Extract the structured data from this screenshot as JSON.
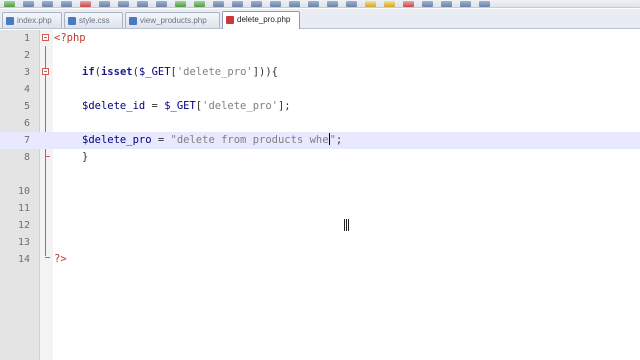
{
  "tabs": [
    {
      "label": "index.php",
      "active": false
    },
    {
      "label": "style.css",
      "active": false
    },
    {
      "label": "view_products.php",
      "active": false
    },
    {
      "label": "delete_pro.php",
      "active": true
    }
  ],
  "lines": [
    {
      "num": "1",
      "text": "<?php"
    },
    {
      "num": "2",
      "text": ""
    },
    {
      "num": "3",
      "text": "if(isset($_GET['delete_pro'])){"
    },
    {
      "num": "4",
      "text": ""
    },
    {
      "num": "5",
      "text": "$delete_id = $_GET['delete_pro'];"
    },
    {
      "num": "6",
      "text": ""
    },
    {
      "num": "7",
      "text": "$delete_pro = \"delete from products whe\";"
    },
    {
      "num": "8",
      "text": "}"
    },
    {
      "num": "10",
      "text": ""
    },
    {
      "num": "11",
      "text": ""
    },
    {
      "num": "12",
      "text": ""
    },
    {
      "num": "13",
      "text": ""
    },
    {
      "num": "14",
      "text": "?>"
    }
  ],
  "tokens": {
    "php_open": "<?php",
    "php_close": "?>",
    "if_kw": "if",
    "paren_open": "(",
    "isset_kw": "isset",
    "get_var": "$_GET",
    "bracket_open": "[",
    "delete_pro_key": "'delete_pro'",
    "if_close": "])){",
    "delete_id_var": "$delete_id",
    "assign": " = ",
    "line5_end": "];",
    "delete_pro_var": "$delete_pro",
    "string_before_caret": "\"delete from products whe",
    "string_after_caret": "\"",
    "semicolon": ";",
    "close_brace": "}"
  }
}
